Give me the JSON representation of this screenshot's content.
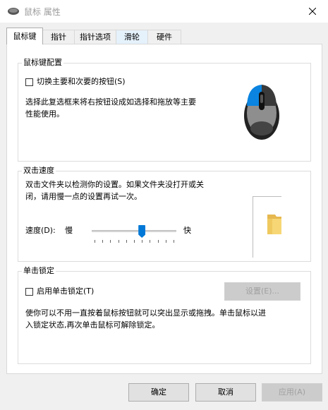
{
  "window": {
    "title": "鼠标 属性"
  },
  "tabs": [
    {
      "label": "鼠标键",
      "state": "active"
    },
    {
      "label": "指针",
      "state": "normal"
    },
    {
      "label": "指针选项",
      "state": "normal"
    },
    {
      "label": "滑轮",
      "state": "hover"
    },
    {
      "label": "硬件",
      "state": "normal"
    }
  ],
  "button_config": {
    "group_label": "鼠标键配置",
    "checkbox_label": "切换主要和次要的按钮(S)",
    "checked": false,
    "description_line1": "选择此复选框来将右按钮设成如选择和拖放等主要",
    "description_line2": "性能使用。"
  },
  "double_click": {
    "group_label": "双击速度",
    "description_line1": "双击文件夹以检测你的设置。如果文件夹没打开或关",
    "description_line2": "闭，请用慢一点的设置再试一次。",
    "speed_label": "速度(D):",
    "slow_label": "慢",
    "fast_label": "快",
    "speed_value": 0.6,
    "tick_count": 11
  },
  "click_lock": {
    "group_label": "单击锁定",
    "checkbox_label": "启用单击锁定(T)",
    "checked": false,
    "settings_button": "设置(E)...",
    "description_line1": "使你可以不用一直按着鼠标按钮就可以突出显示或拖拽。单击鼠标以进",
    "description_line2": "入锁定状态,再次单击鼠标可解除锁定。"
  },
  "footer": {
    "ok": "确定",
    "cancel": "取消",
    "apply": "应用(A)"
  },
  "colors": {
    "accent": "#0078d7",
    "disabled_text": "#a0a0a0"
  },
  "icons": [
    "mouse-title-icon",
    "close-icon",
    "mouse-icon",
    "folder-icon"
  ]
}
